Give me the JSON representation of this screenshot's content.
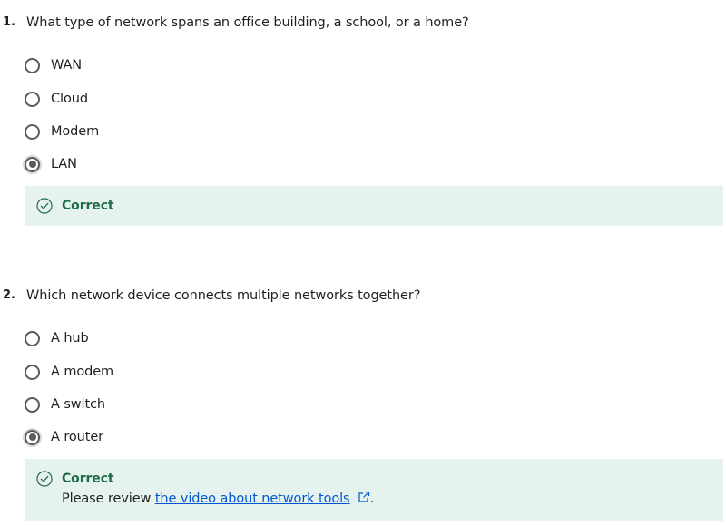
{
  "questions": [
    {
      "number": "1.",
      "text": "What type of network spans an office building, a school, or a home?",
      "options": [
        {
          "label": "WAN",
          "selected": false
        },
        {
          "label": "Cloud",
          "selected": false
        },
        {
          "label": "Modem",
          "selected": false
        },
        {
          "label": "LAN",
          "selected": true
        }
      ],
      "feedback": {
        "status": "Correct"
      }
    },
    {
      "number": "2.",
      "text": "Which network device connects multiple networks together?",
      "options": [
        {
          "label": "A hub",
          "selected": false
        },
        {
          "label": "A modem",
          "selected": false
        },
        {
          "label": "A switch",
          "selected": false
        },
        {
          "label": "A router",
          "selected": true
        }
      ],
      "feedback": {
        "status": "Correct",
        "note_prefix": "Please review ",
        "link_text": "the video about network tools",
        "note_suffix": "."
      }
    }
  ],
  "colors": {
    "correct_bg": "#e6f2ed",
    "correct_text": "#1e6b4a",
    "link": "#0056d2",
    "radio": "#5b5b5b"
  },
  "icons": {
    "feedback_status": "check-circle-icon",
    "external_link": "external-link-icon",
    "selected_radio": "radio-checked",
    "unselected_radio": "radio-unchecked"
  }
}
